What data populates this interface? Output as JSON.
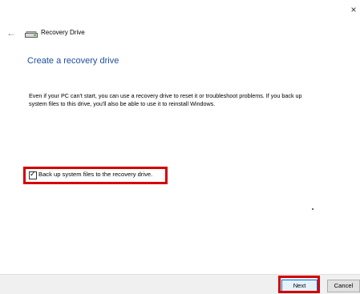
{
  "window": {
    "close_glyph": "×",
    "back_glyph": "←",
    "title": "Recovery Drive",
    "icons": {
      "back": "back-arrow-icon",
      "drive": "drive-icon",
      "close": "close-icon"
    }
  },
  "main": {
    "heading": "Create a recovery drive",
    "description": "Even if your PC can't start, you can use a recovery drive to reset it or troubleshoot problems. If you back up system files to this drive, you'll also be able to use it to reinstall Windows.",
    "backup_checkbox": {
      "label": "Back up system files to the recovery drive.",
      "checked": true
    }
  },
  "footer": {
    "next_label": "Next",
    "cancel_label": "Cancel"
  },
  "colors": {
    "heading": "#1f4e9b",
    "highlight": "#d40000",
    "footer_bg": "#f0f0f0"
  }
}
